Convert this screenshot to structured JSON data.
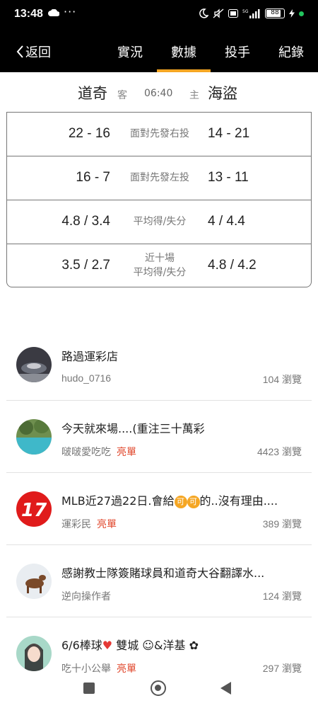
{
  "status_bar": {
    "time": "13:48",
    "more": "···",
    "battery": "88",
    "icons": [
      "cloud-icon",
      "moon-icon",
      "mute-icon",
      "volte-icon",
      "signal-5g-icon",
      "battery-icon",
      "charging-icon"
    ]
  },
  "nav": {
    "back_label": "返回",
    "tabs": [
      {
        "label": "實況"
      },
      {
        "label": "數據",
        "active": true
      },
      {
        "label": "投手"
      },
      {
        "label": "紀錄"
      }
    ],
    "accent_color": "#f5a623"
  },
  "match": {
    "away_team": "道奇",
    "away_tag": "客",
    "time": "06:40",
    "home_tag": "主",
    "home_team": "海盜"
  },
  "stats": [
    {
      "away": "22 - 16",
      "label": "面對先發右投",
      "home": "14 - 21"
    },
    {
      "away": "16 - 7",
      "label": "面對先發左投",
      "home": "13 - 11"
    },
    {
      "away": "4.8 / 3.4",
      "label": "平均得/失分",
      "home": "4 / 4.4"
    },
    {
      "away": "3.5 / 2.7",
      "label_line1": "近十場",
      "label_line2": "平均得/失分",
      "home": "4.8 / 4.2"
    }
  ],
  "posts": [
    {
      "title": "路過運彩店",
      "author": "hudo_0716",
      "tag": "",
      "views": "104 瀏覽"
    },
    {
      "title": "今天就來場....(重注三十萬彩",
      "author": "啵啵愛吃吃",
      "tag": "亮單",
      "views": "4423 瀏覽"
    },
    {
      "title_part1": "MLB近27過22日.會給",
      "coin": "可",
      "title_part2": "的..沒有理由....",
      "author": "運彩民",
      "tag": "亮單",
      "views": "389 瀏覽"
    },
    {
      "title": "感謝教士隊簽賭球員和道奇大谷翻譯水...",
      "author": "逆向操作者",
      "tag": "",
      "views": "124 瀏覽"
    },
    {
      "title_part1": "6/6棒球",
      "title_part2": " 雙城",
      "title_part3": "&洋基",
      "author": "吃十小公舉",
      "tag": "亮單",
      "views": "297 瀏覽"
    }
  ],
  "colors": {
    "tag_red": "#e0452a",
    "header_bg": "#000000"
  }
}
